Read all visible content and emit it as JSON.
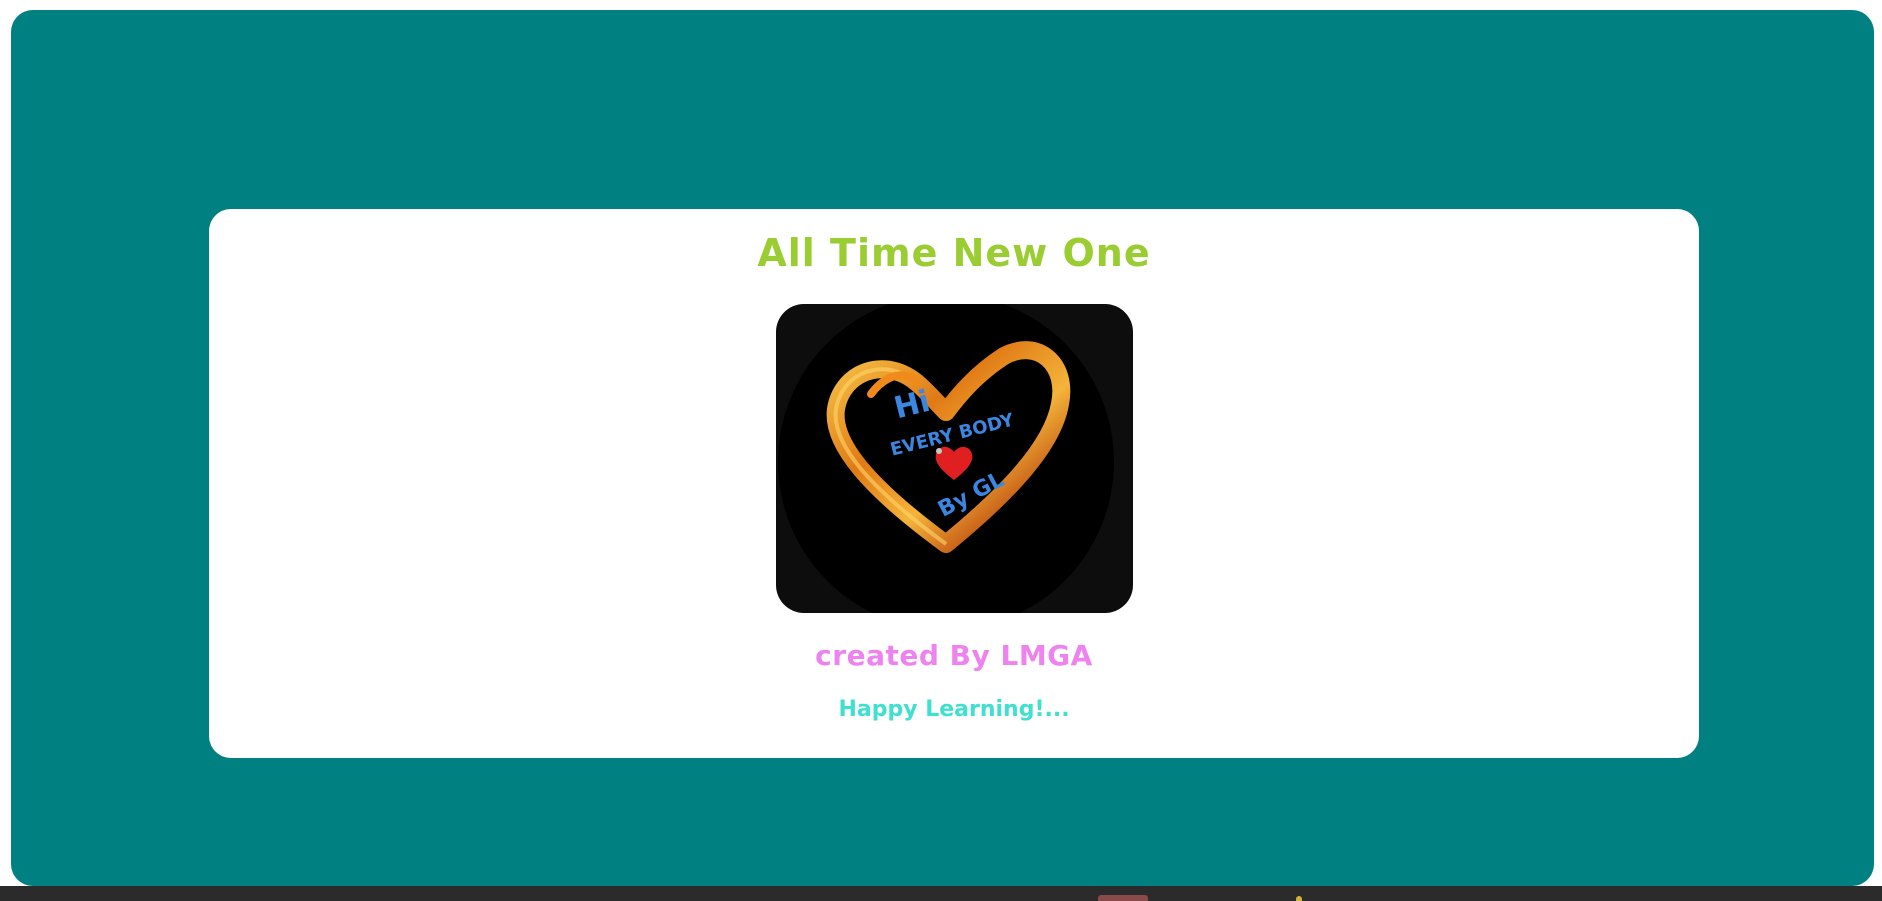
{
  "page": {
    "title": "All Time New One",
    "creator_text": "created By LMGA",
    "tagline": "Happy Learning!..."
  },
  "logo": {
    "icon": "heart-logo-icon",
    "text_line1": "Hi",
    "text_line2": "EVERY BODY",
    "text_line3": "By GL"
  },
  "colors": {
    "background_panel": "#008080",
    "card": "#ffffff",
    "title": "#9acd32",
    "creator": "#ee82ee",
    "tagline": "#40e0d0",
    "logo_text": "#3a86e0",
    "heart_outline": "#e8921e",
    "small_heart": "#e02020"
  }
}
